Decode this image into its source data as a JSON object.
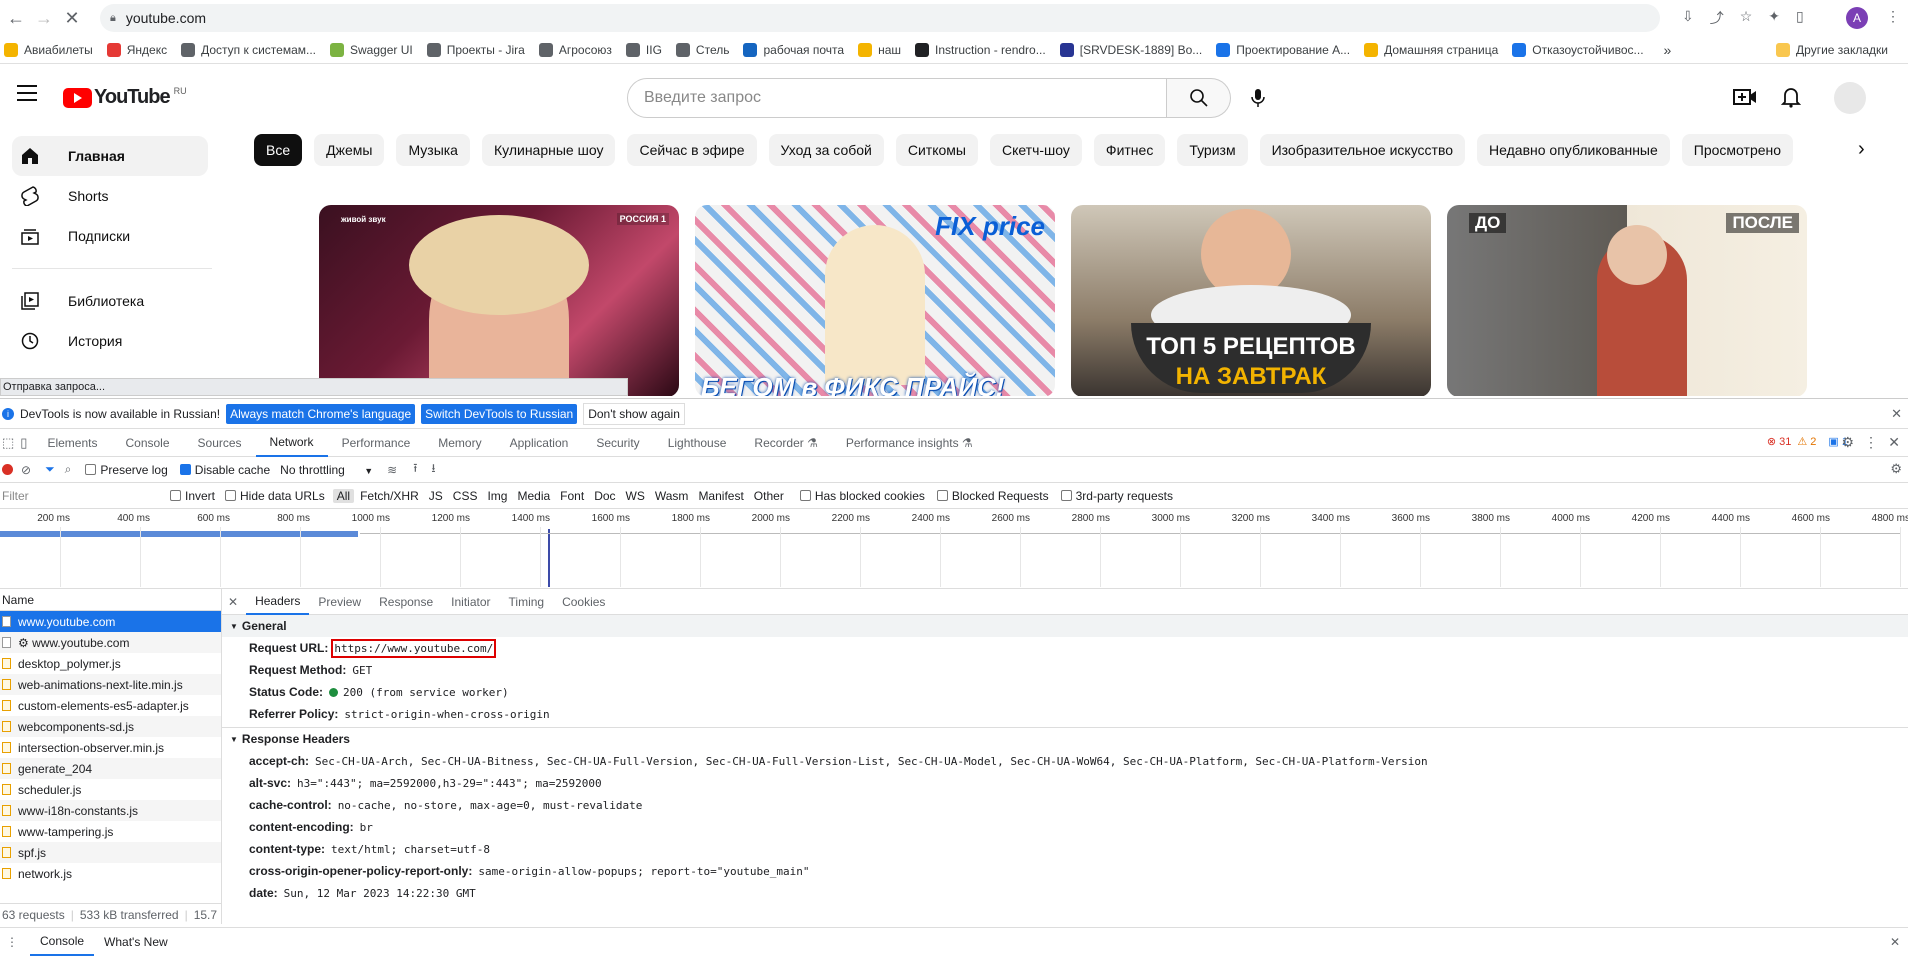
{
  "browser": {
    "url": "youtube.com",
    "bookmarks": [
      "Авиабилеты",
      "Яндекс",
      "Доступ к системам...",
      "Swagger UI",
      "Проекты - Jira",
      "Агросоюз",
      "IIG",
      "Стель",
      "рабочая почта",
      "наш",
      "Instruction - rendro...",
      "[SRVDESK-1889] Во...",
      "Проектирование А...",
      "Домашняя страница",
      "Отказоустойчивос..."
    ],
    "bookmarks_overflow": "»",
    "other_bookmarks": "Другие закладки",
    "avatar_letter": "A"
  },
  "youtube": {
    "logo_text": "YouTube",
    "region": "RU",
    "search_placeholder": "Введите запрос",
    "sidebar": [
      "Главная",
      "Shorts",
      "Подписки",
      "Библиотека",
      "История"
    ],
    "chips": [
      "Все",
      "Джемы",
      "Музыка",
      "Кулинарные шоу",
      "Сейчас в эфире",
      "Уход за собой",
      "Ситкомы",
      "Скетч-шоу",
      "Фитнес",
      "Туризм",
      "Изобразительное искусство",
      "Недавно опубликованные",
      "Просмотрено"
    ],
    "thumbs": [
      {
        "tag": "живой звук",
        "badge": "РОССИЯ 1"
      },
      {
        "caption": "БЕГОМ в ФИКС ПРАЙС!",
        "brand": "FIX price"
      },
      {
        "line1": "ТОП 5 РЕЦЕПТОВ",
        "line2": "НА ЗАВТРАК"
      },
      {
        "left": "ДО",
        "right": "ПОСЛЕ"
      }
    ],
    "status": "Отправка запроса..."
  },
  "devtools": {
    "infobar": {
      "text": "DevTools is now available in Russian!",
      "btn1": "Always match Chrome's language",
      "btn2": "Switch DevTools to Russian",
      "btn3": "Don't show again"
    },
    "tabs": [
      "Elements",
      "Console",
      "Sources",
      "Network",
      "Performance",
      "Memory",
      "Application",
      "Security",
      "Lighthouse",
      "Recorder ⚗",
      "Performance insights ⚗"
    ],
    "counts": {
      "errors": "31",
      "warnings": "2",
      "messages": "1"
    },
    "toolbar": {
      "preserve_log": "Preserve log",
      "disable_cache": "Disable cache",
      "throttling": "No throttling"
    },
    "filter": {
      "placeholder": "Filter",
      "invert": "Invert",
      "hide_data": "Hide data URLs",
      "types": [
        "All",
        "Fetch/XHR",
        "JS",
        "CSS",
        "Img",
        "Media",
        "Font",
        "Doc",
        "WS",
        "Wasm",
        "Manifest",
        "Other"
      ],
      "blocked_cookies": "Has blocked cookies",
      "blocked_requests": "Blocked Requests",
      "third_party": "3rd-party requests"
    },
    "timeline_ticks": [
      "200 ms",
      "400 ms",
      "600 ms",
      "800 ms",
      "1000 ms",
      "1200 ms",
      "1400 ms",
      "1600 ms",
      "1800 ms",
      "2000 ms",
      "2200 ms",
      "2400 ms",
      "2600 ms",
      "2800 ms",
      "3000 ms",
      "3200 ms",
      "3400 ms",
      "3600 ms",
      "3800 ms",
      "4000 ms",
      "4200 ms",
      "4400 ms",
      "4600 ms",
      "4800 ms"
    ],
    "list_header": "Name",
    "requests": [
      "www.youtube.com",
      "⚙ www.youtube.com",
      "desktop_polymer.js",
      "web-animations-next-lite.min.js",
      "custom-elements-es5-adapter.js",
      "webcomponents-sd.js",
      "intersection-observer.min.js",
      "generate_204",
      "scheduler.js",
      "www-i18n-constants.js",
      "www-tampering.js",
      "spf.js",
      "network.js"
    ],
    "detail_tabs": [
      "Headers",
      "Preview",
      "Response",
      "Initiator",
      "Timing",
      "Cookies"
    ],
    "general": {
      "title": "General",
      "rows": [
        {
          "k": "Request URL:",
          "v": "https://www.youtube.com/"
        },
        {
          "k": "Request Method:",
          "v": "GET"
        },
        {
          "k": "Status Code:",
          "v": "200  (from service worker)"
        },
        {
          "k": "Referrer Policy:",
          "v": "strict-origin-when-cross-origin"
        }
      ]
    },
    "response_headers": {
      "title": "Response Headers",
      "rows": [
        {
          "k": "accept-ch:",
          "v": "Sec-CH-UA-Arch, Sec-CH-UA-Bitness, Sec-CH-UA-Full-Version, Sec-CH-UA-Full-Version-List, Sec-CH-UA-Model, Sec-CH-UA-WoW64, Sec-CH-UA-Platform, Sec-CH-UA-Platform-Version"
        },
        {
          "k": "alt-svc:",
          "v": "h3=\":443\"; ma=2592000,h3-29=\":443\"; ma=2592000"
        },
        {
          "k": "cache-control:",
          "v": "no-cache, no-store, max-age=0, must-revalidate"
        },
        {
          "k": "content-encoding:",
          "v": "br"
        },
        {
          "k": "content-type:",
          "v": "text/html; charset=utf-8"
        },
        {
          "k": "cross-origin-opener-policy-report-only:",
          "v": "same-origin-allow-popups; report-to=\"youtube_main\""
        },
        {
          "k": "date:",
          "v": "Sun, 12 Mar 2023 14:22:30 GMT"
        }
      ]
    },
    "summary": {
      "requests": "63 requests",
      "transferred": "533 kB transferred",
      "size": "15.7"
    },
    "drawer": [
      "Console",
      "What's New"
    ]
  }
}
